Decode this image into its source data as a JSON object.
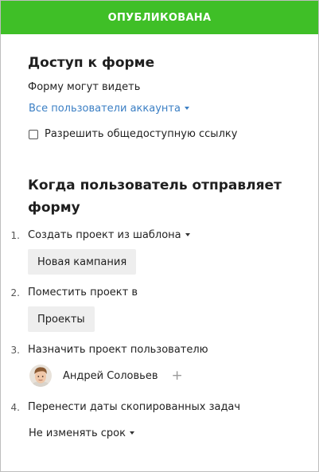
{
  "status_banner": "ОПУБЛИКОВАНА",
  "access": {
    "title": "Доступ к форме",
    "visibility_label": "Форму могут видеть",
    "visibility_value": "Все пользователи аккаунта",
    "public_link_label": "Разрешить общедоступную ссылку"
  },
  "submit": {
    "title": "Когда пользователь отправляет форму",
    "steps": [
      {
        "num": "1.",
        "text": "Создать проект из шаблона",
        "value": "Новая кампания"
      },
      {
        "num": "2.",
        "text": "Поместить проект в",
        "value": "Проекты"
      },
      {
        "num": "3.",
        "text": "Назначить проект пользователю",
        "value": "Андрей Соловьев"
      },
      {
        "num": "4.",
        "text": "Перенести даты скопированных задач",
        "value": "Не изменять срок"
      }
    ]
  },
  "icons": {
    "plus": "plus-icon",
    "dropdown": "caret-down-icon"
  },
  "colors": {
    "banner": "#3fbf27",
    "link": "#3b7fc4",
    "button_bg": "#eeeeee"
  }
}
